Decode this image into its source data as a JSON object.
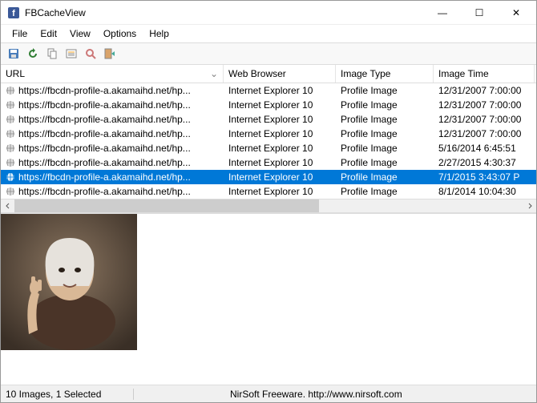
{
  "window": {
    "title": "FBCacheView",
    "icons": {
      "minimize": "—",
      "maximize": "☐",
      "close": "✕"
    }
  },
  "menu": [
    "File",
    "Edit",
    "View",
    "Options",
    "Help"
  ],
  "toolbar": {
    "items": [
      {
        "name": "save-icon"
      },
      {
        "name": "refresh-icon"
      },
      {
        "name": "copy-icon"
      },
      {
        "name": "properties-icon"
      },
      {
        "name": "find-icon"
      },
      {
        "name": "exit-icon"
      }
    ]
  },
  "columns": {
    "url": "URL",
    "browser": "Web Browser",
    "type": "Image Type",
    "time": "Image Time"
  },
  "rows": [
    {
      "url": "https://fbcdn-profile-a.akamaihd.net/hp...",
      "browser": "Internet Explorer 10",
      "type": "Profile Image",
      "time": "12/31/2007 7:00:00",
      "selected": false
    },
    {
      "url": "https://fbcdn-profile-a.akamaihd.net/hp...",
      "browser": "Internet Explorer 10",
      "type": "Profile Image",
      "time": "12/31/2007 7:00:00",
      "selected": false
    },
    {
      "url": "https://fbcdn-profile-a.akamaihd.net/hp...",
      "browser": "Internet Explorer 10",
      "type": "Profile Image",
      "time": "12/31/2007 7:00:00",
      "selected": false
    },
    {
      "url": "https://fbcdn-profile-a.akamaihd.net/hp...",
      "browser": "Internet Explorer 10",
      "type": "Profile Image",
      "time": "12/31/2007 7:00:00",
      "selected": false
    },
    {
      "url": "https://fbcdn-profile-a.akamaihd.net/hp...",
      "browser": "Internet Explorer 10",
      "type": "Profile Image",
      "time": "5/16/2014 6:45:51",
      "selected": false
    },
    {
      "url": "https://fbcdn-profile-a.akamaihd.net/hp...",
      "browser": "Internet Explorer 10",
      "type": "Profile Image",
      "time": "2/27/2015 4:30:37",
      "selected": false
    },
    {
      "url": "https://fbcdn-profile-a.akamaihd.net/hp...",
      "browser": "Internet Explorer 10",
      "type": "Profile Image",
      "time": "7/1/2015 3:43:07 P",
      "selected": true
    },
    {
      "url": "https://fbcdn-profile-a.akamaihd.net/hp...",
      "browser": "Internet Explorer 10",
      "type": "Profile Image",
      "time": "8/1/2014 10:04:30",
      "selected": false
    }
  ],
  "status": {
    "left": "10 Images, 1 Selected",
    "right": "NirSoft Freeware.  http://www.nirsoft.com"
  },
  "colors": {
    "selection": "#0078d7"
  }
}
